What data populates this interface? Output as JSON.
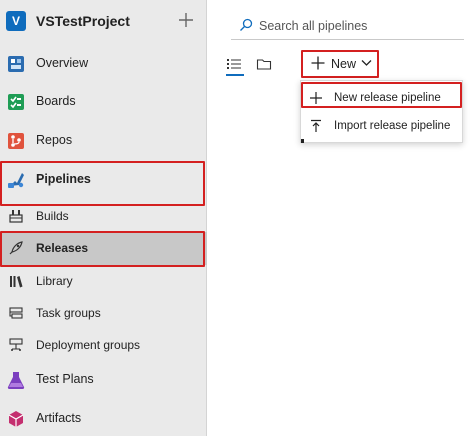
{
  "project": {
    "avatar_letter": "V",
    "name": "VSTestProject"
  },
  "sidebar": {
    "items": [
      {
        "label": "Overview"
      },
      {
        "label": "Boards"
      },
      {
        "label": "Repos"
      },
      {
        "label": "Pipelines"
      },
      {
        "label": "Builds"
      },
      {
        "label": "Releases"
      },
      {
        "label": "Library"
      },
      {
        "label": "Task groups"
      },
      {
        "label": "Deployment groups"
      },
      {
        "label": "Test Plans"
      },
      {
        "label": "Artifacts"
      }
    ]
  },
  "search": {
    "placeholder": "Search all pipelines"
  },
  "toolbar": {
    "new_label": "New"
  },
  "new_menu": {
    "items": [
      {
        "label": "New release pipeline",
        "icon": "plus-icon"
      },
      {
        "label": "Import release pipeline",
        "icon": "import-icon"
      }
    ]
  },
  "colors": {
    "accent": "#0f6cbd",
    "highlight": "#d42020",
    "selected": "#c8c8c8"
  }
}
